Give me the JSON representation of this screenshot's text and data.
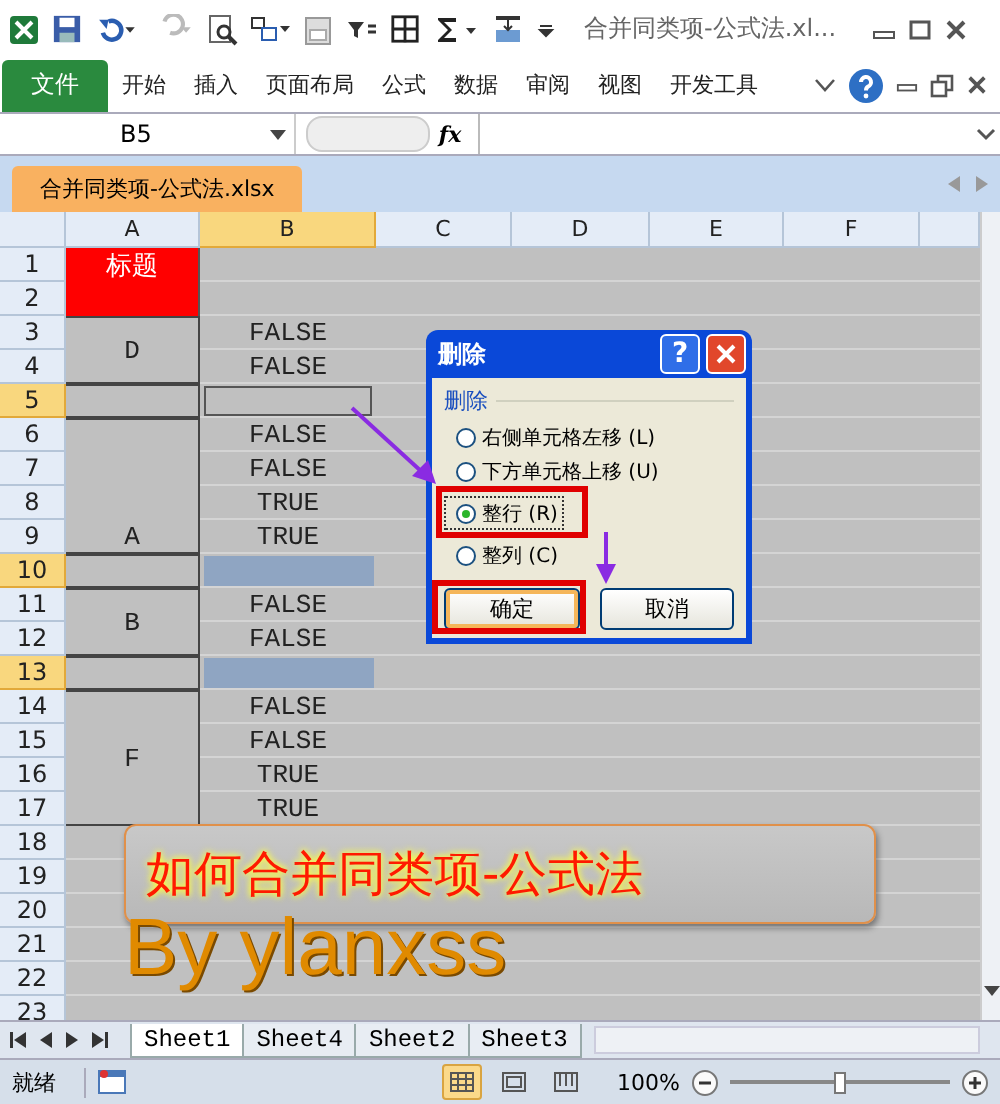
{
  "window": {
    "title": "合并同类项-公式法.xl..."
  },
  "ribbon": {
    "file_tab": "文件",
    "tabs": [
      "开始",
      "插入",
      "页面布局",
      "公式",
      "数据",
      "审阅",
      "视图",
      "开发工具"
    ]
  },
  "formula_bar": {
    "name_box": "B5",
    "fx": "fx"
  },
  "workbook_tab": "合并同类项-公式法.xlsx",
  "columns": [
    {
      "label": "A",
      "selected": false
    },
    {
      "label": "B",
      "selected": true
    },
    {
      "label": "C",
      "selected": false
    },
    {
      "label": "D",
      "selected": false
    },
    {
      "label": "E",
      "selected": false
    },
    {
      "label": "F",
      "selected": false
    }
  ],
  "rows": [
    {
      "label": "1",
      "selected": false
    },
    {
      "label": "2",
      "selected": false
    },
    {
      "label": "3",
      "selected": false
    },
    {
      "label": "4",
      "selected": false
    },
    {
      "label": "5",
      "selected": true
    },
    {
      "label": "6",
      "selected": false
    },
    {
      "label": "7",
      "selected": false
    },
    {
      "label": "8",
      "selected": false
    },
    {
      "label": "9",
      "selected": false
    },
    {
      "label": "10",
      "selected": true
    },
    {
      "label": "11",
      "selected": false
    },
    {
      "label": "12",
      "selected": false
    },
    {
      "label": "13",
      "selected": true
    },
    {
      "label": "14",
      "selected": false
    },
    {
      "label": "15",
      "selected": false
    },
    {
      "label": "16",
      "selected": false
    },
    {
      "label": "17",
      "selected": false
    },
    {
      "label": "18",
      "selected": false
    },
    {
      "label": "19",
      "selected": false
    },
    {
      "label": "20",
      "selected": false
    },
    {
      "label": "21",
      "selected": false
    },
    {
      "label": "22",
      "selected": false
    },
    {
      "label": "23",
      "selected": false
    }
  ],
  "column_a": [
    {
      "kind": "title",
      "text": "标题"
    },
    {
      "kind": "title"
    },
    {
      "kind": "merged",
      "text": "D"
    },
    {
      "kind": "continued"
    },
    {
      "kind": "merged"
    },
    {
      "kind": "merged-bottom",
      "text": "A"
    },
    {
      "kind": "continued"
    },
    {
      "kind": "continued"
    },
    {
      "kind": "continued"
    },
    {
      "kind": "merged"
    },
    {
      "kind": "merged",
      "text": "B"
    },
    {
      "kind": "continued"
    },
    {
      "kind": "merged"
    },
    {
      "kind": "merged",
      "text": "F"
    },
    {
      "kind": "continued"
    },
    {
      "kind": "continued"
    },
    {
      "kind": "continued"
    }
  ],
  "column_b": [
    {
      "kind": "empty"
    },
    {
      "kind": "empty"
    },
    {
      "kind": "value",
      "text": "FALSE"
    },
    {
      "kind": "value",
      "text": "FALSE"
    },
    {
      "kind": "active"
    },
    {
      "kind": "value",
      "text": "FALSE"
    },
    {
      "kind": "value",
      "text": "FALSE"
    },
    {
      "kind": "value",
      "text": "TRUE"
    },
    {
      "kind": "value",
      "text": "TRUE"
    },
    {
      "kind": "highlight"
    },
    {
      "kind": "value",
      "text": "FALSE"
    },
    {
      "kind": "value",
      "text": "FALSE"
    },
    {
      "kind": "highlight"
    },
    {
      "kind": "value",
      "text": "FALSE"
    },
    {
      "kind": "value",
      "text": "FALSE"
    },
    {
      "kind": "value",
      "text": "TRUE"
    },
    {
      "kind": "value",
      "text": "TRUE"
    }
  ],
  "dialog": {
    "title": "删除",
    "help": "?",
    "group": "删除",
    "options": [
      {
        "label": "右侧单元格左移 (L)",
        "selected": false
      },
      {
        "label": "下方单元格上移 (U)",
        "selected": false
      },
      {
        "label": "整行 (R)",
        "selected": true
      },
      {
        "label": "整列 (C)",
        "selected": false
      }
    ],
    "buttons": [
      {
        "label": "确定",
        "default": true
      },
      {
        "label": "取消",
        "default": false
      }
    ]
  },
  "banner": {
    "title": "如何合并同类项-公式法",
    "byline": "By ylanxss"
  },
  "sheet_tabs": [
    {
      "label": "Sheet1",
      "selected": true
    },
    {
      "label": "Sheet4",
      "selected": false
    },
    {
      "label": "Sheet2",
      "selected": false
    },
    {
      "label": "Sheet3",
      "selected": false
    }
  ],
  "status_bar": {
    "status": "就绪",
    "zoom": "100%",
    "zoom_slider": {
      "level": 0.5
    },
    "views": [
      {
        "kind": "normal",
        "selected": true
      },
      {
        "kind": "layout",
        "selected": false
      },
      {
        "kind": "pagebreak",
        "selected": false
      }
    ]
  }
}
